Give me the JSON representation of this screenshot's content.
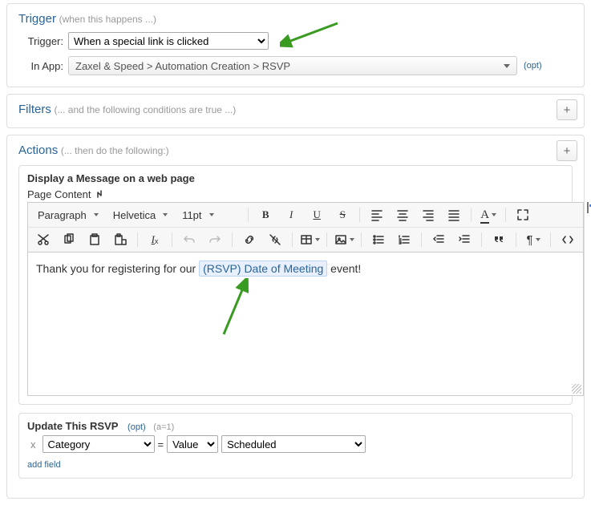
{
  "trigger": {
    "title": "Trigger",
    "subtitle": "(when this happens ...)",
    "label_trigger": "Trigger:",
    "label_app": "In App:",
    "sel_trigger": "When a special link is clicked",
    "sel_app": "Zaxel & Speed > Automation Creation > RSVP",
    "opt": "(opt)"
  },
  "filters": {
    "title": "Filters",
    "subtitle": "(... and the following conditions are true ...)",
    "add": "+"
  },
  "actions": {
    "title": "Actions",
    "subtitle": "(... then do the following:)",
    "add": "+",
    "display_title": "Display a Message on a web page",
    "page_content": "Page Content",
    "tb": {
      "para": "Paragraph",
      "font": "Helvetica",
      "size": "11pt"
    },
    "body_pre": "Thank you for registering for our ",
    "body_token": "(RSVP) Date of Meeting",
    "body_post": " event!",
    "update_title": "Update This RSVP",
    "opt": "(opt)",
    "a1": "(a=1)",
    "x": "x",
    "field": "Category",
    "eq": "=",
    "value_sel": "Value",
    "value_val": "Scheduled",
    "add_field": "add field"
  }
}
